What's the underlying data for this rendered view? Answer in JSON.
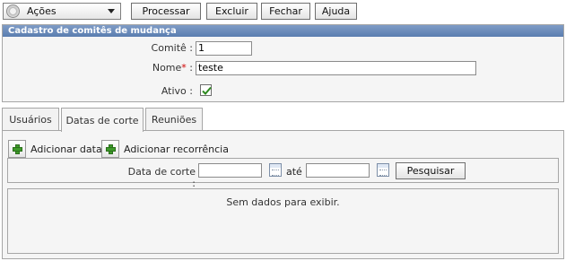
{
  "toolbar": {
    "actions_label": "Ações",
    "buttons": [
      "Processar",
      "Excluir",
      "Fechar",
      "Ajuda"
    ]
  },
  "cadastro": {
    "title": "Cadastro de comitês de mudança",
    "comite_label": "Comitê :",
    "comite_value": "1",
    "nome_label": "Nome",
    "nome_required": "*",
    "nome_colon": " :",
    "nome_value": "teste",
    "ativo_label": "Ativo :",
    "ativo_checked": true
  },
  "tabs": [
    {
      "label": "Usuários",
      "active": false
    },
    {
      "label": "Datas de corte",
      "active": true
    },
    {
      "label": "Reuniões",
      "active": false
    }
  ],
  "datas": {
    "add_date_label": "Adicionar data",
    "add_recurrence_label": "Adicionar recorrência",
    "filter_label": "Data de corte :",
    "from_value": "",
    "until_label": "até",
    "to_value": "",
    "search_label": "Pesquisar",
    "empty_text": "Sem dados para exibir."
  },
  "colors": {
    "header_blue": "#5a7db0",
    "required_red": "#d00000",
    "check_green": "#2d8a1f"
  }
}
